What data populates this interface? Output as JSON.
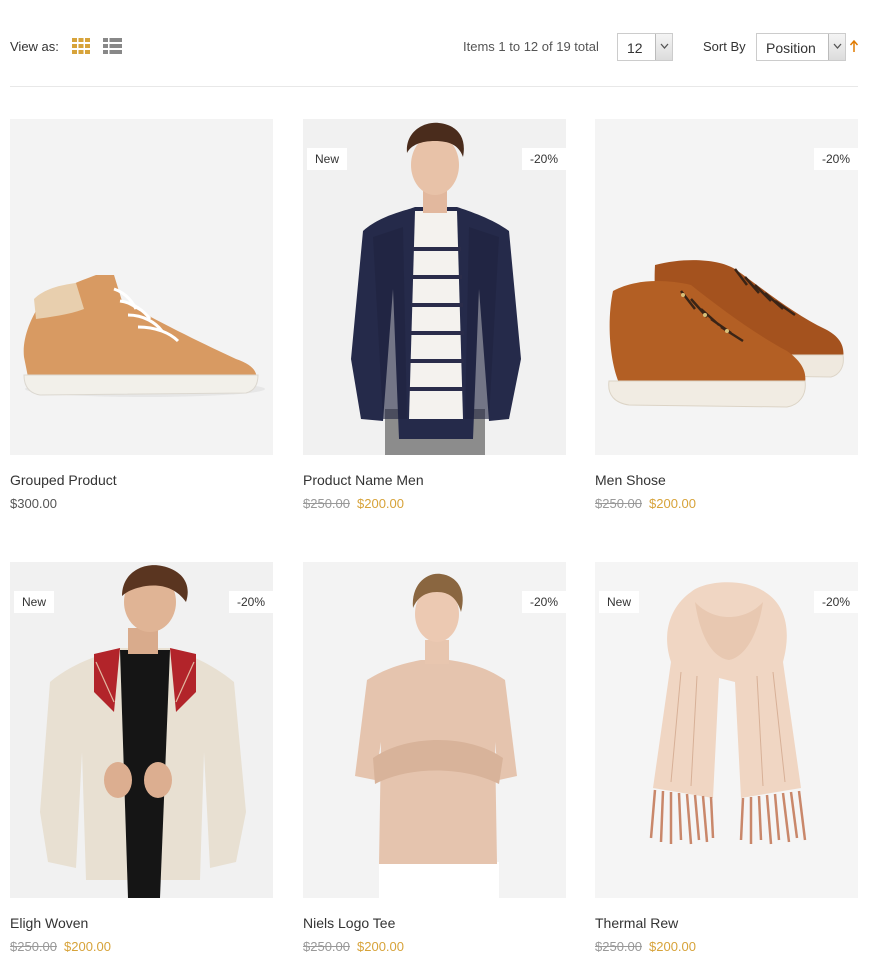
{
  "toolbar": {
    "view_as_label": "View as:",
    "items_text": "Items 1 to 12 of 19 total",
    "limiter_value": "12",
    "sort_label": "Sort By",
    "sort_value": "Position"
  },
  "colors": {
    "accent": "#d7a33a",
    "sort_arrow": "#e07a00"
  },
  "products": [
    {
      "name": "Grouped Product",
      "price": "$300.00",
      "image_icon": "high-top-sneaker"
    },
    {
      "name": "Product Name Men",
      "badge_new": "New",
      "badge_sale": "-20%",
      "old_price": "$250.00",
      "price": "$200.00",
      "image_icon": "man-jacket"
    },
    {
      "name": "Men Shose",
      "badge_sale": "-20%",
      "old_price": "$250.00",
      "price": "$200.00",
      "image_icon": "leather-shoes"
    },
    {
      "name": "Eligh Woven",
      "badge_new": "New",
      "badge_sale": "-20%",
      "old_price": "$250.00",
      "price": "$200.00",
      "image_icon": "man-bomber-jacket"
    },
    {
      "name": "Niels Logo Tee",
      "badge_sale": "-20%",
      "old_price": "$250.00",
      "price": "$200.00",
      "image_icon": "woman-sweater"
    },
    {
      "name": "Thermal Rew",
      "badge_new": "New",
      "badge_sale": "-20%",
      "old_price": "$250.00",
      "price": "$200.00",
      "image_icon": "scarf"
    }
  ]
}
